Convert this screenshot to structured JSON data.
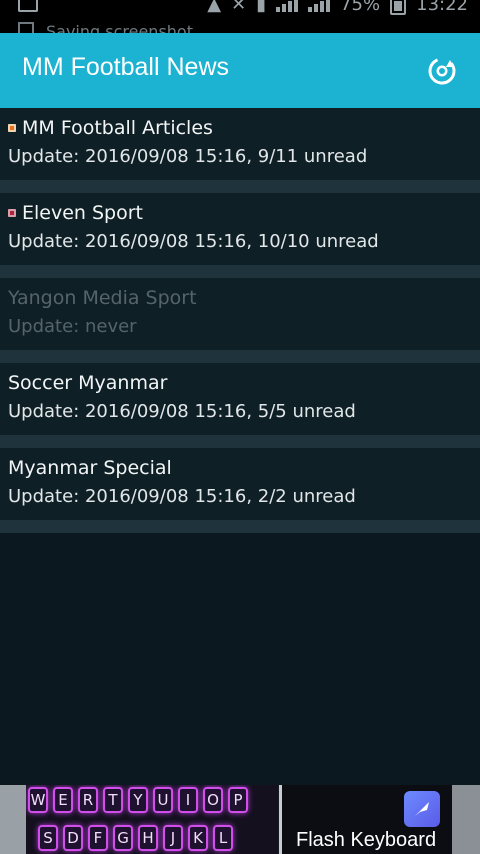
{
  "status_bar": {
    "toast": "Saving screenshot...",
    "battery": "75%",
    "time": "13:22"
  },
  "app_bar": {
    "title": "MM Football News",
    "refresh_icon": "refresh-icon"
  },
  "feeds": [
    {
      "title": "MM Football Articles",
      "subtitle": "Update: 2016/09/08 15:16, 9/11 unread",
      "favicon": "orange",
      "dim": false
    },
    {
      "title": "Eleven Sport",
      "subtitle": "Update: 2016/09/08 15:16, 10/10 unread",
      "favicon": "red",
      "dim": false
    },
    {
      "title": "Yangon Media Sport",
      "subtitle": "Update: never",
      "favicon": "",
      "dim": true
    },
    {
      "title": "Soccer Myanmar",
      "subtitle": "Update: 2016/09/08 15:16, 5/5 unread",
      "favicon": "",
      "dim": false
    },
    {
      "title": "Myanmar Special",
      "subtitle": "Update: 2016/09/08 15:16, 2/2 unread",
      "favicon": "",
      "dim": false
    }
  ],
  "ad": {
    "title": "Flash Keyboard",
    "keys_top": [
      "W",
      "E",
      "R",
      "T",
      "Y",
      "U",
      "I",
      "O",
      "P"
    ],
    "keys_bottom": [
      "S",
      "D",
      "F",
      "G",
      "H",
      "J",
      "K",
      "L"
    ]
  },
  "colors": {
    "app_bar": "#1bb3d1",
    "background": "#0b1820",
    "item_bg": "#0f1f26",
    "separator": "#1e333b"
  }
}
